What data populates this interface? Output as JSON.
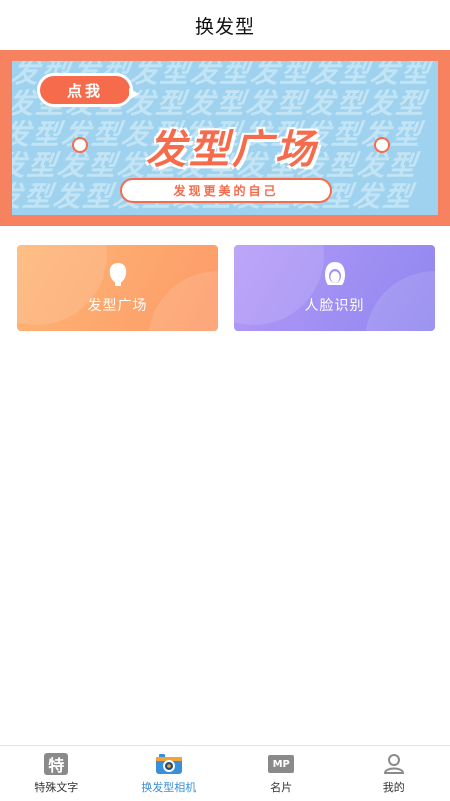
{
  "header": {
    "title": "换发型"
  },
  "banner": {
    "bubble_label": "点我",
    "title": "发型广场",
    "subtitle": "发现更美的自己",
    "pattern_text": "发型发型发型发型发型发型发型"
  },
  "cards": [
    {
      "label": "发型广场",
      "icon": "hair-head-icon"
    },
    {
      "label": "人脸识别",
      "icon": "face-icon"
    }
  ],
  "tabbar": {
    "items": [
      {
        "label": "特殊文字",
        "icon": "special-text-icon",
        "icon_text": "特"
      },
      {
        "label": "换发型相机",
        "icon": "camera-icon"
      },
      {
        "label": "名片",
        "icon": "business-card-icon",
        "icon_text": "MP"
      },
      {
        "label": "我的",
        "icon": "user-icon"
      }
    ],
    "active_index": 1
  },
  "colors": {
    "banner_orange": "#f7825f",
    "banner_blue": "#9ed2ee",
    "accent_blue": "#3a8fd8",
    "card_orange": "#fd9a68",
    "card_purple": "#8f86ef"
  }
}
